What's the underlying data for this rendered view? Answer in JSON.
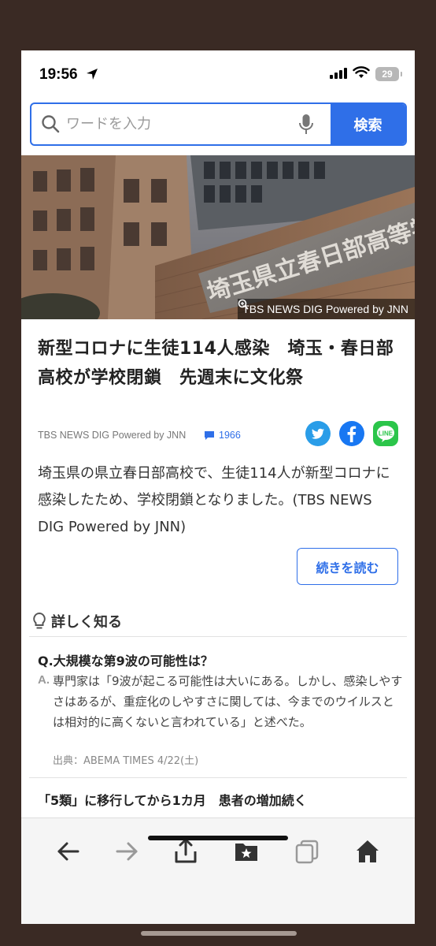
{
  "status_bar": {
    "time": "19:56",
    "battery": "29"
  },
  "search": {
    "placeholder": "ワードを入力",
    "button_label": "検索"
  },
  "hero": {
    "credit": "TBS NEWS DIG Powered by JNN",
    "sign_text": "埼玉県立春日部高等学校"
  },
  "article": {
    "headline": "新型コロナに生徒114人感染　埼玉・春日部高校が学校閉鎖　先週末に文化祭",
    "source": "TBS NEWS DIG Powered by JNN",
    "comment_count": "1966",
    "summary": "埼玉県の県立春日部高校で、生徒114人が新型コロナに感染したため、学校閉鎖となりました。(TBS NEWS DIG Powered by JNN)",
    "read_more_label": "続きを読む"
  },
  "share": {
    "line_label": "LINE"
  },
  "learn_more": {
    "title": "詳しく知る",
    "question": "Q.大規模な第9波の可能性は？",
    "answer_label": "A.",
    "answer": "専門家は「9波が起こる可能性は大いにある。しかし、感染しやすさはあるが、重症化のしやすさに関しては、今までのウイルスとは相対的に高くないと言われている」と述べた。",
    "citation": "出典：ABEMA TIMES  4/22(土)"
  },
  "next_article": {
    "headline": "「5類」に移行してから1カ月　患者の増加続く"
  },
  "colors": {
    "accent": "#2f6fe8",
    "twitter": "#2a9de8",
    "facebook": "#1877f2",
    "line": "#2bc54a",
    "background": "#3a2a24"
  }
}
